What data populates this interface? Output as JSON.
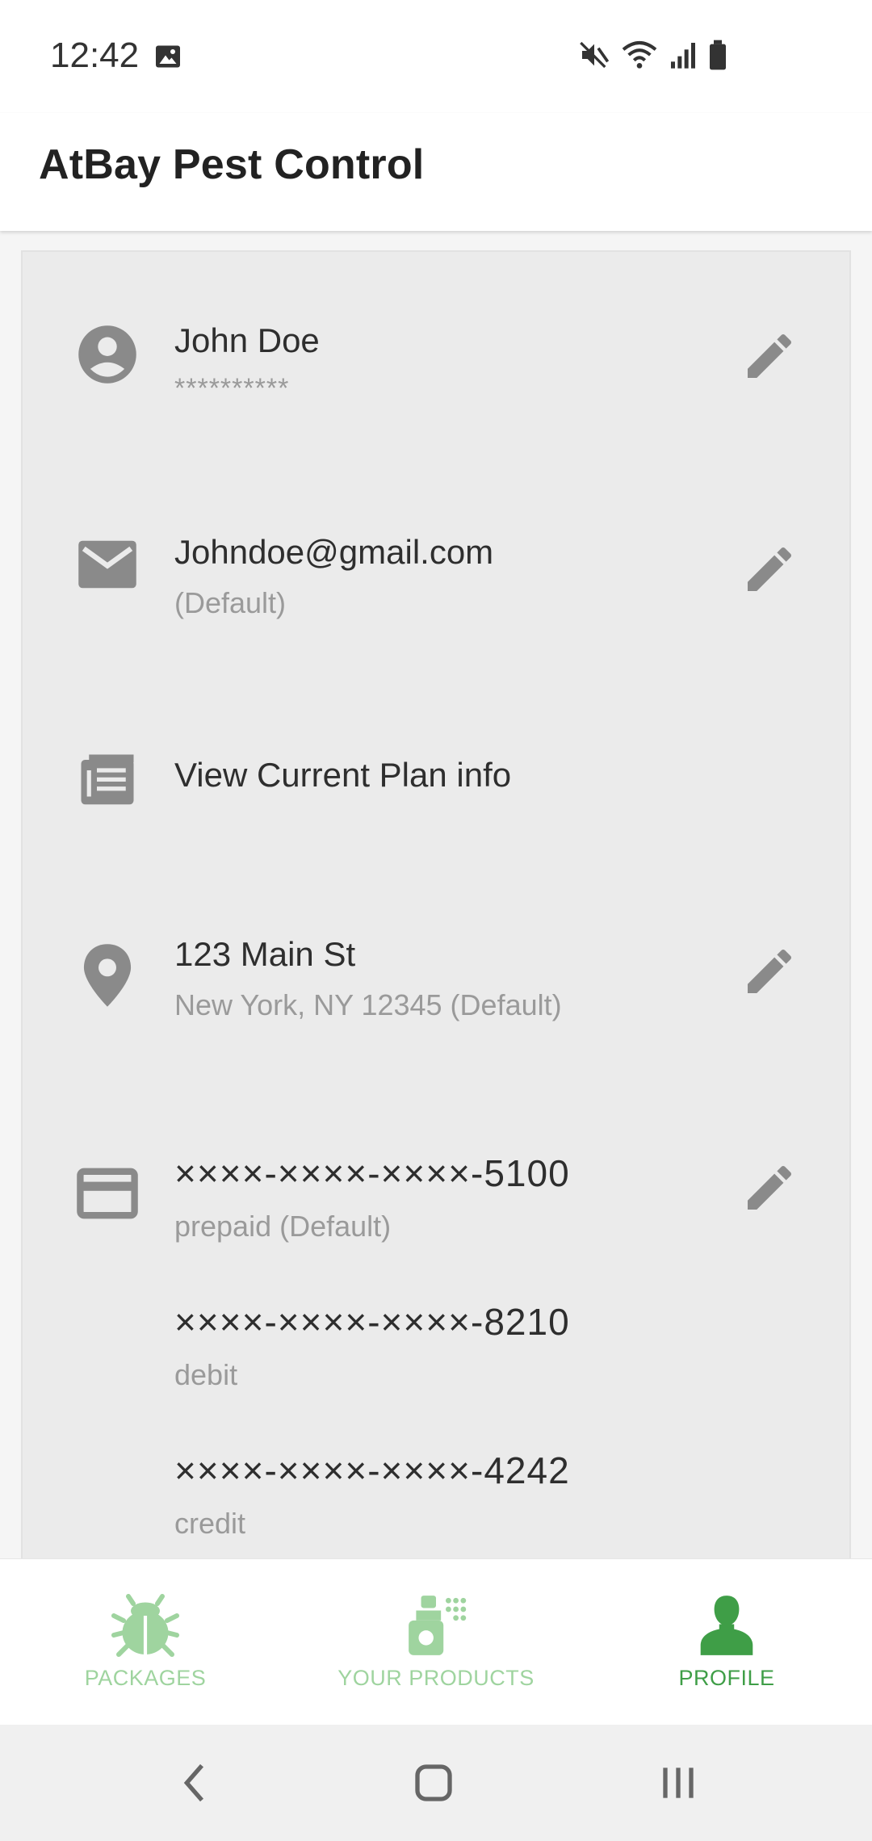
{
  "status_bar": {
    "time": "12:42",
    "icons": [
      "image-icon",
      "mute-icon",
      "wifi-icon",
      "signal-icon",
      "battery-icon"
    ]
  },
  "app": {
    "title": "AtBay Pest Control"
  },
  "profile": {
    "name": {
      "icon": "account-circle-icon",
      "primary": "John Doe",
      "secondary": "**********"
    },
    "email": {
      "icon": "mail-icon",
      "primary": "Johndoe@gmail.com",
      "secondary": "(Default)"
    },
    "plan": {
      "icon": "article-icon",
      "primary": "View Current Plan info"
    },
    "address": {
      "icon": "location-pin-icon",
      "primary": "123 Main St",
      "secondary": "New York, NY 12345 (Default)"
    },
    "payment": {
      "icon": "credit-card-icon",
      "cards": [
        {
          "number": "××××-××××-××××-5100",
          "type": "prepaid (Default)"
        },
        {
          "number": "××××-××××-××××-8210",
          "type": "debit"
        },
        {
          "number": "××××-××××-××××-4242",
          "type": "credit"
        }
      ]
    }
  },
  "bottom_nav": {
    "items": [
      {
        "label": "PACKAGES",
        "icon": "bug-icon",
        "active": false
      },
      {
        "label": "YOUR PRODUCTS",
        "icon": "spray-bottle-icon",
        "active": false
      },
      {
        "label": "PROFILE",
        "icon": "person-icon",
        "active": true
      }
    ]
  },
  "colors": {
    "accent_active": "#3f9e47",
    "accent_inactive": "#9fd49f",
    "icon_gray": "#8a8a8a",
    "card_background": "#ebebeb"
  }
}
